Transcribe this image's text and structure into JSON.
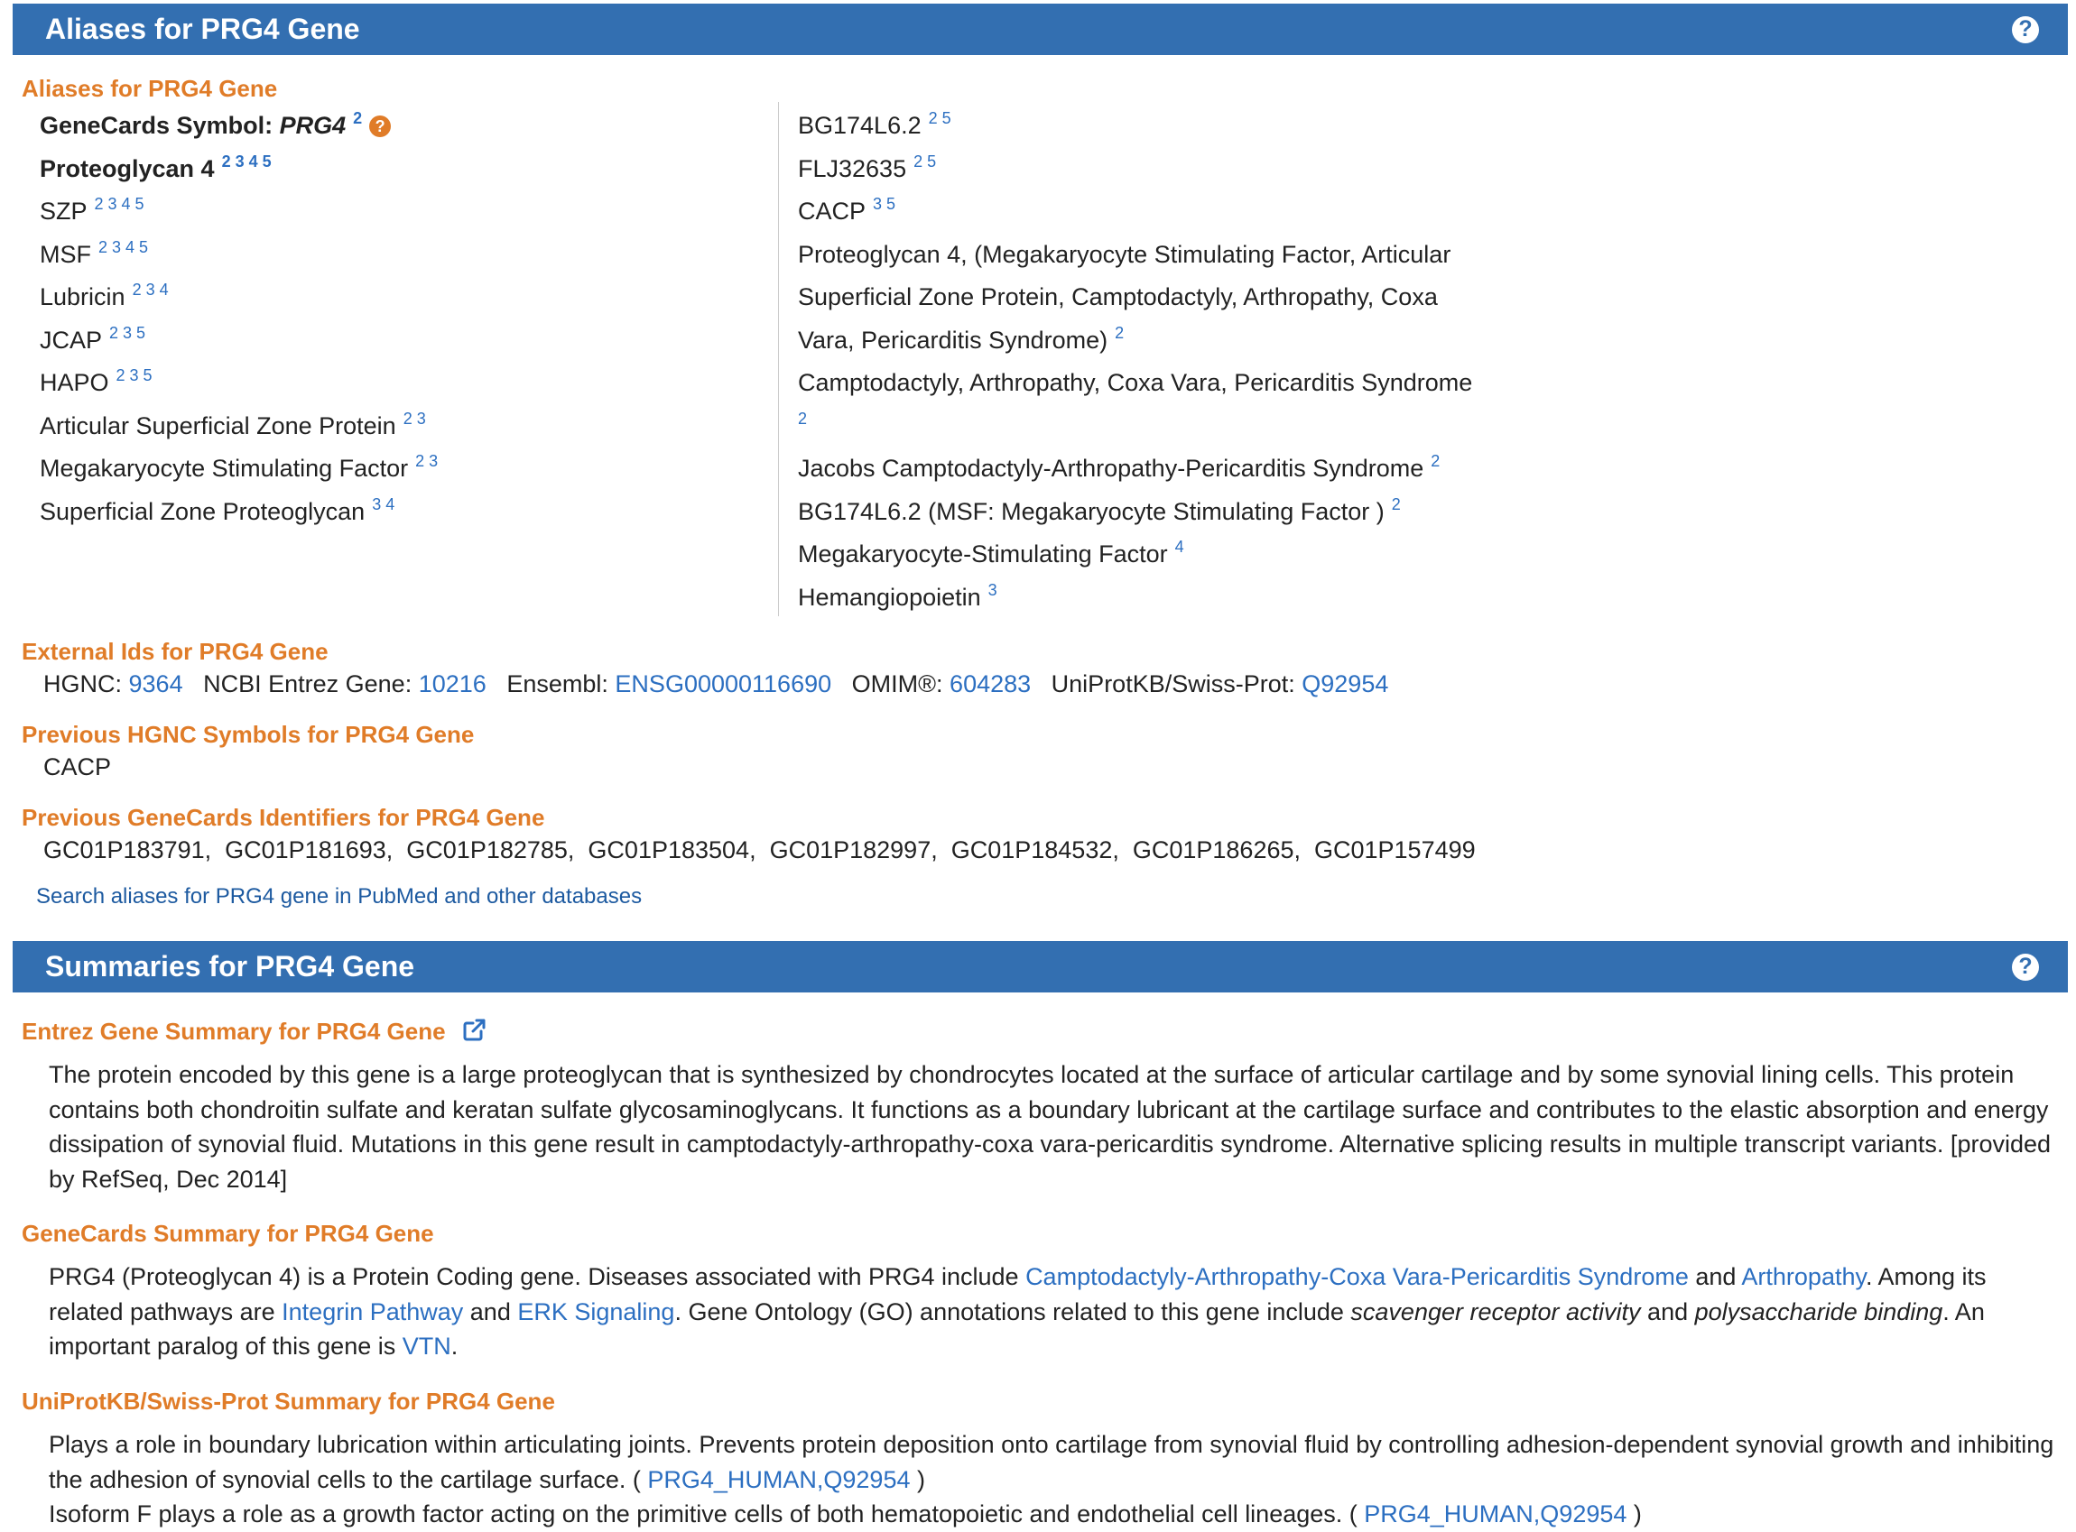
{
  "aliases_section": {
    "header": "Aliases for PRG4 Gene",
    "subheader": "Aliases for PRG4 Gene",
    "left": [
      {
        "name": "GeneCards Symbol: ",
        "italic": "PRG4",
        "refs": "2",
        "help": "?"
      },
      {
        "name": "Proteoglycan 4",
        "refs": "2 3 4 5"
      },
      {
        "name": "SZP",
        "refs": "2 3 4 5"
      },
      {
        "name": "MSF",
        "refs": "2 3 4 5"
      },
      {
        "name": "Lubricin",
        "refs": "2 3 4"
      },
      {
        "name": "JCAP",
        "refs": "2 3 5"
      },
      {
        "name": "HAPO",
        "refs": "2 3 5"
      },
      {
        "name": "Articular Superficial Zone Protein",
        "refs": "2 3"
      },
      {
        "name": "Megakaryocyte Stimulating Factor",
        "refs": "2 3"
      },
      {
        "name": "Superficial Zone Proteoglycan",
        "refs": "3 4"
      }
    ],
    "right": [
      {
        "name": "BG174L6.2",
        "refs": "2 5"
      },
      {
        "name": "FLJ32635",
        "refs": "2 5"
      },
      {
        "name": "CACP",
        "refs": "3 5"
      },
      {
        "name": "Proteoglycan 4, (Megakaryocyte Stimulating Factor, Articular",
        "refs": ""
      },
      {
        "name": "Superficial Zone Protein, Camptodactyly, Arthropathy, Coxa",
        "refs": ""
      },
      {
        "name": "Vara, Pericarditis Syndrome)",
        "refs": "2"
      },
      {
        "name": "Camptodactyly, Arthropathy, Coxa Vara, Pericarditis Syndrome",
        "refs": ""
      },
      {
        "name": "",
        "refs": "2"
      },
      {
        "name": "Jacobs Camptodactyly-Arthropathy-Pericarditis Syndrome",
        "refs": "2"
      },
      {
        "name": "BG174L6.2 (MSF: Megakaryocyte Stimulating Factor )",
        "refs": "2"
      },
      {
        "name": "Megakaryocyte-Stimulating Factor",
        "refs": "4"
      },
      {
        "name": "Hemangiopoietin",
        "refs": "3"
      }
    ]
  },
  "external_ids": {
    "heading": "External Ids for PRG4 Gene",
    "hgnc_label": "HGNC:",
    "hgnc": "9364",
    "entrez_label": "NCBI Entrez Gene:",
    "entrez": "10216",
    "ensembl_label": "Ensembl:",
    "ensembl": "ENSG00000116690",
    "omim_label": "OMIM®:",
    "omim": "604283",
    "uniprot_label": "UniProtKB/Swiss-Prot:",
    "uniprot": "Q92954"
  },
  "previous_hgnc": {
    "heading": "Previous HGNC Symbols for PRG4 Gene",
    "value": "CACP"
  },
  "previous_genecards": {
    "heading": "Previous GeneCards Identifiers for PRG4 Gene",
    "value": "GC01P183791,  GC01P181693,  GC01P182785,  GC01P183504,  GC01P182997,  GC01P184532,  GC01P186265,  GC01P157499"
  },
  "search_link": "Search aliases for PRG4 gene in PubMed and other databases",
  "summaries_section": {
    "header": "Summaries for PRG4 Gene",
    "entrez": {
      "heading": "Entrez Gene Summary for PRG4 Gene",
      "text": "The protein encoded by this gene is a large proteoglycan that is synthesized by chondrocytes located at the surface of articular cartilage and by some synovial lining cells. This protein contains both chondroitin sulfate and keratan sulfate glycosaminoglycans. It functions as a boundary lubricant at the cartilage surface and contributes to the elastic absorption and energy dissipation of synovial fluid. Mutations in this gene result in camptodactyly-arthropathy-coxa vara-pericarditis syndrome. Alternative splicing results in multiple transcript variants. [provided by RefSeq, Dec 2014]"
    },
    "genecards": {
      "heading": "GeneCards Summary for PRG4 Gene",
      "t1": "PRG4 (Proteoglycan 4) is a Protein Coding gene. Diseases associated with PRG4 include ",
      "l1": "Camptodactyly-Arthropathy-Coxa Vara-Pericarditis Syndrome",
      "t2": " and ",
      "l2": "Arthropathy",
      "t3": ". Among its related pathways are ",
      "l3": "Integrin Pathway",
      "t4": " and ",
      "l4": "ERK Signaling",
      "t5": ". Gene Ontology (GO) annotations related to this gene include ",
      "i1": "scavenger receptor activity",
      "t6": " and ",
      "i2": "polysaccharide binding",
      "t7": ". An important paralog of this gene is ",
      "l5": "VTN",
      "t8": "."
    },
    "uniprot": {
      "heading": "UniProtKB/Swiss-Prot Summary for PRG4 Gene",
      "p1": "Plays a role in boundary lubrication within articulating joints. Prevents protein deposition onto cartilage from synovial fluid by controlling adhesion-dependent synovial growth and inhibiting the adhesion of synovial cells to the cartilage surface. ( ",
      "p1_link": "PRG4_HUMAN,Q92954",
      "p1_end": " )",
      "p2": "Isoform F plays a role as a growth factor acting on the primitive cells of both hematopoietic and endothelial cell lineages. ( ",
      "p2_link": "PRG4_HUMAN,Q92954",
      "p2_end": " )"
    }
  },
  "colors": {
    "banner": "#336fb1",
    "heading": "#e07c28",
    "link": "#2c6fc1"
  },
  "icons": {
    "help": "question-circle-icon",
    "external": "external-link-icon"
  }
}
